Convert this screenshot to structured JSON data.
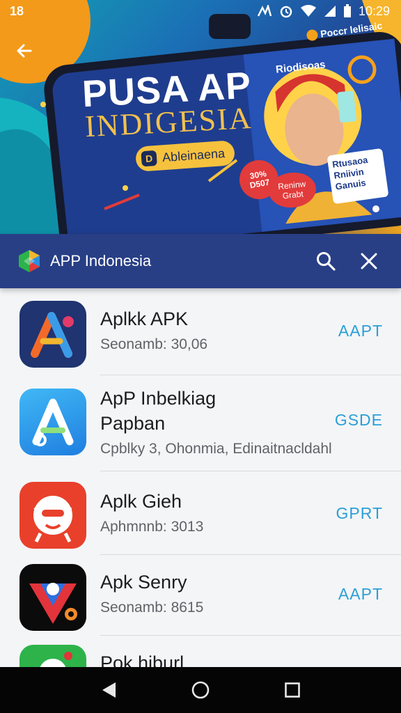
{
  "status_bar": {
    "left_text": "18",
    "time": "10:29",
    "icons": [
      "signal-icon",
      "alarm-icon",
      "wifi-icon",
      "cell-signal-icon",
      "battery-icon"
    ]
  },
  "banner": {
    "title": "PUSA AP",
    "subtitle": "INDIGESIA",
    "pill_icon_letter": "D",
    "pill_text": "Ableinaena",
    "corner_label": "Poccr lelisaic",
    "person_label": "Riodisoas",
    "badge_1": "30%\nD507",
    "badge_2": "Reninw\nGrabt",
    "side_card": "Rtusaoa\nRniivin\nGanuis"
  },
  "app_bar": {
    "title": "APP Indonesia",
    "logo": "app-logo-icon",
    "search_icon": "search-icon",
    "close_icon": "close-icon"
  },
  "apps": [
    {
      "name": "Aplkk APK",
      "meta": "Seonamb: 30,06",
      "button": "AAPT",
      "icon_bg": "#1f3470",
      "icon": "a-letter-icon"
    },
    {
      "name": "ApP Inbelkiag",
      "name2": "Papban",
      "meta": "Cpblky 3, Ohonmia, Edinaitnacldahl",
      "button": "GSDE",
      "icon_bg": "#2a9ae8",
      "icon": "a-letter-icon"
    },
    {
      "name": "Aplk Gieh",
      "meta": "Aphmnnb: 3013",
      "button": "GPRT",
      "icon_bg": "#e8402b",
      "icon": "mascot-icon"
    },
    {
      "name": "Apk Senry",
      "meta": "Seonamb: 8615",
      "button": "AAPT",
      "icon_bg": "#0b0b0b",
      "icon": "shield-icon"
    },
    {
      "name": "Pok hiburl",
      "meta": "",
      "button": "",
      "icon_bg": "#2db34a",
      "icon": "app-icon"
    }
  ],
  "nav": {
    "back": "back-nav-icon",
    "home": "home-nav-icon",
    "recents": "recents-nav-icon"
  }
}
